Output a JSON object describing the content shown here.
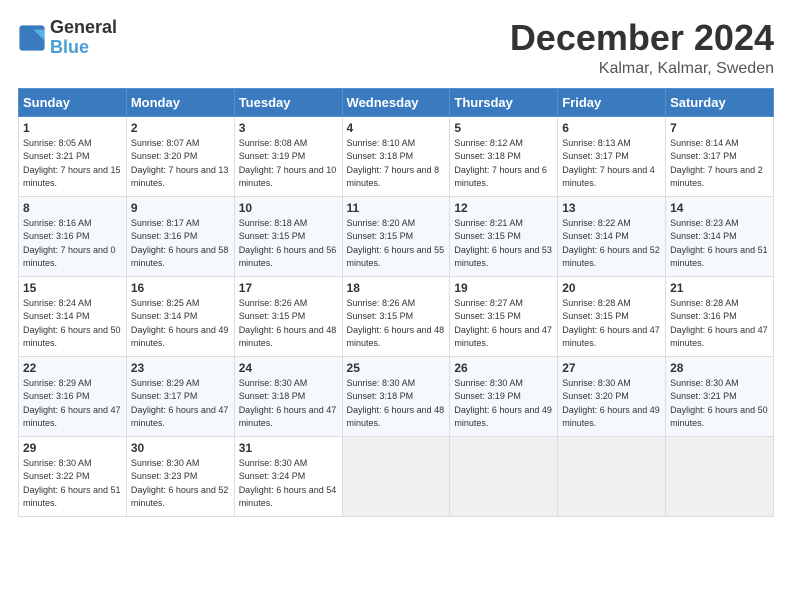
{
  "logo": {
    "line1": "General",
    "line2": "Blue"
  },
  "title": "December 2024",
  "location": "Kalmar, Kalmar, Sweden",
  "days_of_week": [
    "Sunday",
    "Monday",
    "Tuesday",
    "Wednesday",
    "Thursday",
    "Friday",
    "Saturday"
  ],
  "weeks": [
    [
      {
        "day": "1",
        "sunrise": "8:05 AM",
        "sunset": "3:21 PM",
        "daylight": "7 hours and 15 minutes."
      },
      {
        "day": "2",
        "sunrise": "8:07 AM",
        "sunset": "3:20 PM",
        "daylight": "7 hours and 13 minutes."
      },
      {
        "day": "3",
        "sunrise": "8:08 AM",
        "sunset": "3:19 PM",
        "daylight": "7 hours and 10 minutes."
      },
      {
        "day": "4",
        "sunrise": "8:10 AM",
        "sunset": "3:18 PM",
        "daylight": "7 hours and 8 minutes."
      },
      {
        "day": "5",
        "sunrise": "8:12 AM",
        "sunset": "3:18 PM",
        "daylight": "7 hours and 6 minutes."
      },
      {
        "day": "6",
        "sunrise": "8:13 AM",
        "sunset": "3:17 PM",
        "daylight": "7 hours and 4 minutes."
      },
      {
        "day": "7",
        "sunrise": "8:14 AM",
        "sunset": "3:17 PM",
        "daylight": "7 hours and 2 minutes."
      }
    ],
    [
      {
        "day": "8",
        "sunrise": "8:16 AM",
        "sunset": "3:16 PM",
        "daylight": "7 hours and 0 minutes."
      },
      {
        "day": "9",
        "sunrise": "8:17 AM",
        "sunset": "3:16 PM",
        "daylight": "6 hours and 58 minutes."
      },
      {
        "day": "10",
        "sunrise": "8:18 AM",
        "sunset": "3:15 PM",
        "daylight": "6 hours and 56 minutes."
      },
      {
        "day": "11",
        "sunrise": "8:20 AM",
        "sunset": "3:15 PM",
        "daylight": "6 hours and 55 minutes."
      },
      {
        "day": "12",
        "sunrise": "8:21 AM",
        "sunset": "3:15 PM",
        "daylight": "6 hours and 53 minutes."
      },
      {
        "day": "13",
        "sunrise": "8:22 AM",
        "sunset": "3:14 PM",
        "daylight": "6 hours and 52 minutes."
      },
      {
        "day": "14",
        "sunrise": "8:23 AM",
        "sunset": "3:14 PM",
        "daylight": "6 hours and 51 minutes."
      }
    ],
    [
      {
        "day": "15",
        "sunrise": "8:24 AM",
        "sunset": "3:14 PM",
        "daylight": "6 hours and 50 minutes."
      },
      {
        "day": "16",
        "sunrise": "8:25 AM",
        "sunset": "3:14 PM",
        "daylight": "6 hours and 49 minutes."
      },
      {
        "day": "17",
        "sunrise": "8:26 AM",
        "sunset": "3:15 PM",
        "daylight": "6 hours and 48 minutes."
      },
      {
        "day": "18",
        "sunrise": "8:26 AM",
        "sunset": "3:15 PM",
        "daylight": "6 hours and 48 minutes."
      },
      {
        "day": "19",
        "sunrise": "8:27 AM",
        "sunset": "3:15 PM",
        "daylight": "6 hours and 47 minutes."
      },
      {
        "day": "20",
        "sunrise": "8:28 AM",
        "sunset": "3:15 PM",
        "daylight": "6 hours and 47 minutes."
      },
      {
        "day": "21",
        "sunrise": "8:28 AM",
        "sunset": "3:16 PM",
        "daylight": "6 hours and 47 minutes."
      }
    ],
    [
      {
        "day": "22",
        "sunrise": "8:29 AM",
        "sunset": "3:16 PM",
        "daylight": "6 hours and 47 minutes."
      },
      {
        "day": "23",
        "sunrise": "8:29 AM",
        "sunset": "3:17 PM",
        "daylight": "6 hours and 47 minutes."
      },
      {
        "day": "24",
        "sunrise": "8:30 AM",
        "sunset": "3:18 PM",
        "daylight": "6 hours and 47 minutes."
      },
      {
        "day": "25",
        "sunrise": "8:30 AM",
        "sunset": "3:18 PM",
        "daylight": "6 hours and 48 minutes."
      },
      {
        "day": "26",
        "sunrise": "8:30 AM",
        "sunset": "3:19 PM",
        "daylight": "6 hours and 49 minutes."
      },
      {
        "day": "27",
        "sunrise": "8:30 AM",
        "sunset": "3:20 PM",
        "daylight": "6 hours and 49 minutes."
      },
      {
        "day": "28",
        "sunrise": "8:30 AM",
        "sunset": "3:21 PM",
        "daylight": "6 hours and 50 minutes."
      }
    ],
    [
      {
        "day": "29",
        "sunrise": "8:30 AM",
        "sunset": "3:22 PM",
        "daylight": "6 hours and 51 minutes."
      },
      {
        "day": "30",
        "sunrise": "8:30 AM",
        "sunset": "3:23 PM",
        "daylight": "6 hours and 52 minutes."
      },
      {
        "day": "31",
        "sunrise": "8:30 AM",
        "sunset": "3:24 PM",
        "daylight": "6 hours and 54 minutes."
      },
      null,
      null,
      null,
      null
    ]
  ]
}
